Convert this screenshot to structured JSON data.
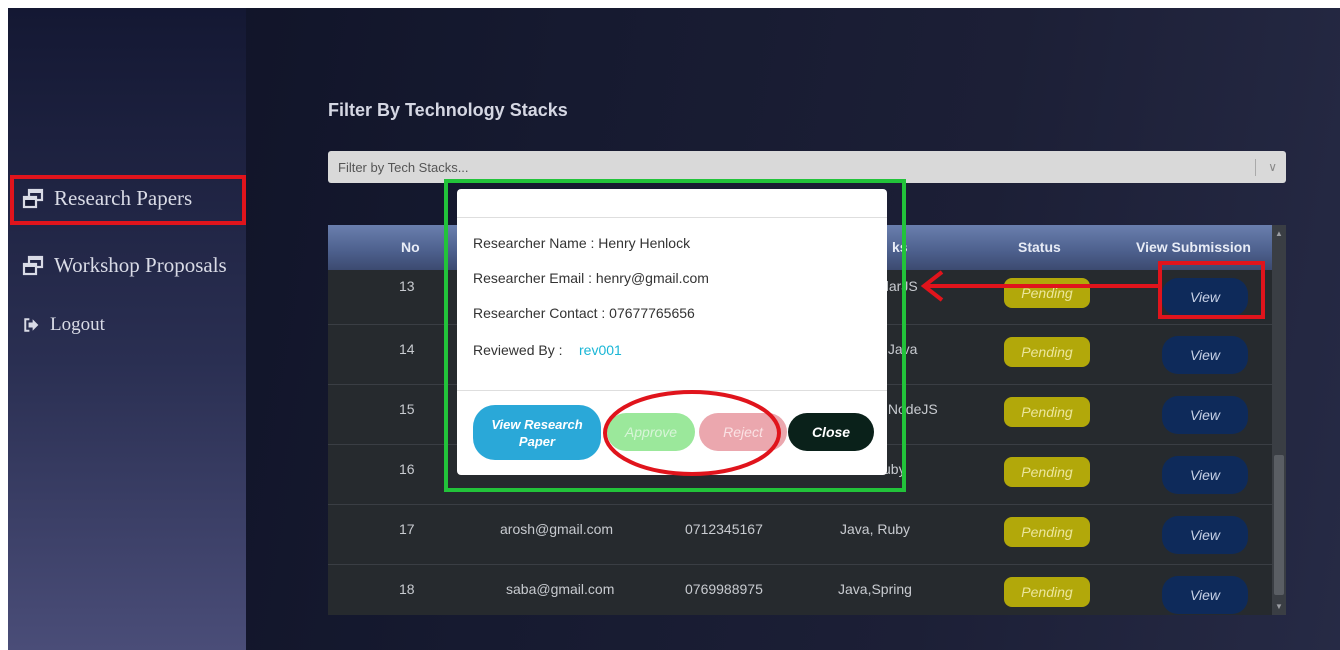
{
  "sidebar": {
    "items": [
      {
        "label": "Research Papers"
      },
      {
        "label": "Workshop Proposals"
      },
      {
        "label": "Logout"
      }
    ]
  },
  "filter": {
    "title": "Filter By Technology Stacks",
    "placeholder": "Filter by Tech Stacks..."
  },
  "table": {
    "headers": {
      "no": "No",
      "tech": "ks",
      "status": "Status",
      "view": "View Submission"
    },
    "rows": [
      {
        "no": "13",
        "email": "",
        "contact": "",
        "tech": "ularJS",
        "status": "Pending",
        "action": "View"
      },
      {
        "no": "14",
        "email": "",
        "contact": "",
        "tech": ",Java",
        "status": "Pending",
        "action": "View"
      },
      {
        "no": "15",
        "email": "",
        "contact": "",
        "tech": ",NodeJS",
        "status": "Pending",
        "action": "View"
      },
      {
        "no": "16",
        "email": "",
        "contact": "",
        "tech": "uby",
        "status": "Pending",
        "action": "View"
      },
      {
        "no": "17",
        "email": "arosh@gmail.com",
        "contact": "0712345167",
        "tech": "Java, Ruby",
        "status": "Pending",
        "action": "View"
      },
      {
        "no": "18",
        "email": "saba@gmail.com",
        "contact": "0769988975",
        "tech": "Java,Spring",
        "status": "Pending",
        "action": "View"
      }
    ]
  },
  "modal": {
    "name": "Researcher Name : Henry Henlock",
    "email": "Researcher Email : henry@gmail.com",
    "contact": "Researcher Contact : 07677765656",
    "reviewed_label": "Reviewed By :",
    "reviewed_value": "rev001",
    "buttons": {
      "view_paper": "View Research Paper",
      "approve": "Approve",
      "reject": "Reject",
      "close": "Close"
    }
  },
  "colors": {
    "annotation_red": "#e0141c",
    "annotation_green": "#22c33a",
    "pending_badge": "#b2a80a",
    "view_button": "#0e2a5a",
    "view_paper_button": "#2aa8d8",
    "close_button": "#0a211a"
  },
  "icons": {
    "nav_item": "window-restore-icon",
    "logout": "sign-out-icon"
  }
}
